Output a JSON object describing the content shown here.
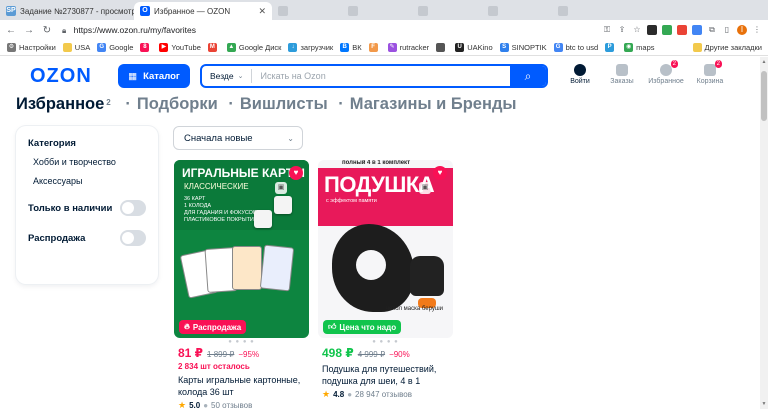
{
  "browser": {
    "tabs": [
      {
        "favicon": "SP",
        "label": "Задание №2730877 - просмотр ...",
        "active": false
      },
      {
        "favicon": "ozon-favicon",
        "label": "Избранное — OZON",
        "active": true
      }
    ],
    "url": "https://www.ozon.ru/my/favorites",
    "bookmarks": [
      {
        "label": "Настройки"
      },
      {
        "label": "USA"
      },
      {
        "label": "Google"
      },
      {
        "label": ""
      },
      {
        "label": "YouTube"
      },
      {
        "label": ""
      },
      {
        "label": "Google Диск"
      },
      {
        "label": "загрузчик"
      },
      {
        "label": "ВК"
      },
      {
        "label": ""
      },
      {
        "label": "rutracker"
      },
      {
        "label": ""
      },
      {
        "label": "UAKino"
      },
      {
        "label": "SINOPTIK"
      },
      {
        "label": "btc to usd"
      },
      {
        "label": ""
      },
      {
        "label": "maps"
      }
    ],
    "other_bookmarks": "Другие закладки"
  },
  "header": {
    "logo": "OZON",
    "catalog_label": "Каталог",
    "search_scope": "Везде",
    "search_placeholder": "Искать на Ozon",
    "icons": [
      {
        "label": "Войти",
        "badge": ""
      },
      {
        "label": "Заказы",
        "badge": ""
      },
      {
        "label": "Избранное",
        "badge": "2"
      },
      {
        "label": "Корзина",
        "badge": "2"
      }
    ]
  },
  "title_nav": {
    "active": "Избранное",
    "count": "2",
    "items": [
      "Подборки",
      "Вишлисты",
      "Магазины и Бренды"
    ]
  },
  "sidebar": {
    "category_heading": "Категория",
    "categories": [
      "Хобби и творчество",
      "Аксессуары"
    ],
    "toggles": [
      {
        "label": "Только в наличии",
        "on": false
      },
      {
        "label": "Распродажа",
        "on": false
      }
    ]
  },
  "sort": {
    "selected": "Сначала новые"
  },
  "products": [
    {
      "image_title": "ИГРАЛЬНЫЕ КАРТЫ",
      "image_subtitle": "КЛАССИЧЕСКИЕ",
      "image_points": [
        "36 КАРТ",
        "1 КОЛОДА",
        "ДЛЯ ГАДАНИЯ И ФОКУСОВ",
        "ПЛАСТИКОВОЕ ПОКРЫТИЕ"
      ],
      "label": "Распродажа",
      "label_color": "#f91155",
      "price": "81 ₽",
      "old_price": "1 899 ₽",
      "discount": "−95%",
      "stock": "2 834 шт осталось",
      "title": "Карты игральные картонные, колода 36 шт",
      "rating": "5.0",
      "reviews": "50 отзывов"
    },
    {
      "image_top": "полный 4 в 1 комплект",
      "image_title": "ПОДУШКА",
      "image_subtitle": "с эффектом памяти",
      "image_note": "чехол маска беруши",
      "label": "Цена что надо",
      "label_color": "#10c44c",
      "price": "498 ₽",
      "old_price": "4 999 ₽",
      "discount": "−90%",
      "stock": "",
      "title": "Подушка для путешествий, подушка для шеи, 4 в 1",
      "rating": "4.8",
      "reviews": "28 947 отзывов"
    }
  ]
}
